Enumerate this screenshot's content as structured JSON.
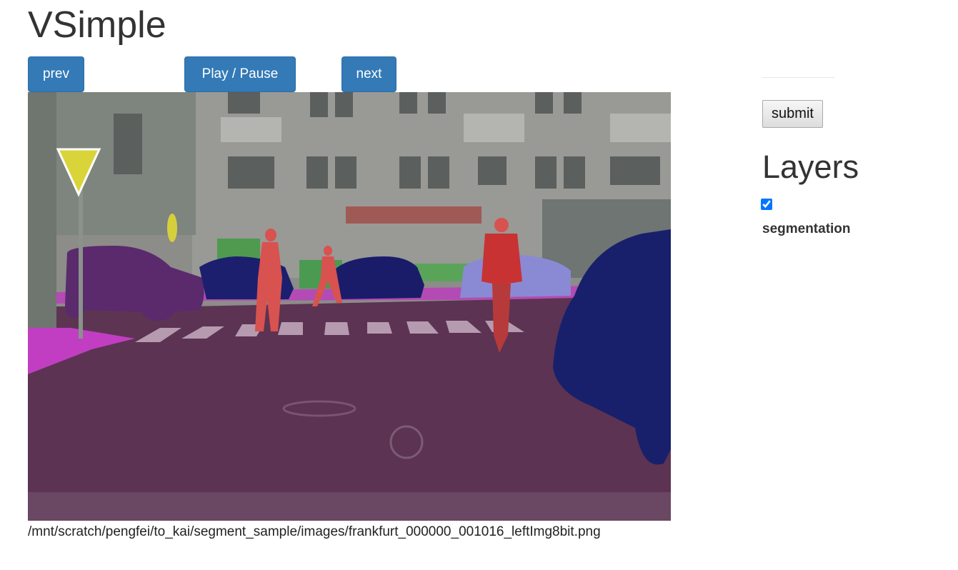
{
  "app": {
    "title": "VSimple"
  },
  "controls": {
    "prev_label": "prev",
    "play_pause_label": "Play / Pause",
    "next_label": "next"
  },
  "frame": {
    "file_path": "/mnt/scratch/pengfei/to_kai/segment_sample/images/frankfurt_000000_001016_leftImg8bit.png"
  },
  "sidebar": {
    "submit_label": "submit",
    "layers_heading": "Layers",
    "layers": [
      {
        "name": "segmentation",
        "checked": true
      }
    ]
  },
  "colors": {
    "button_primary": "#337ab7",
    "seg_road": "#5d3553",
    "seg_car": "#1e1e78",
    "seg_person": "#dc3c3c",
    "seg_sidewalk": "#c83cc8"
  }
}
